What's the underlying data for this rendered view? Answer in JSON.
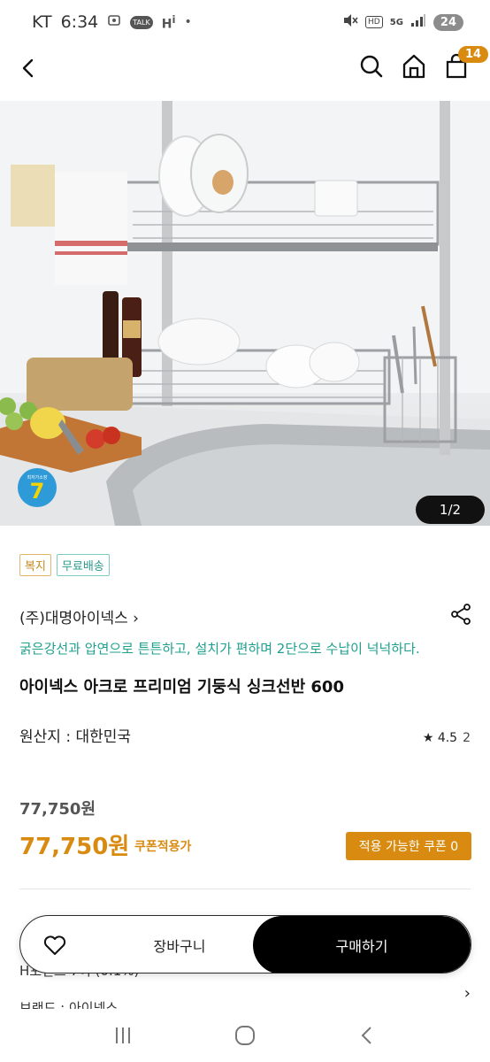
{
  "status_bar": {
    "carrier": "KT",
    "time": "6:34",
    "talk_badge": "TALK",
    "hd_badge": "HD",
    "network": "5G",
    "battery": "24"
  },
  "header": {
    "cart_count": "14",
    "icons": [
      "back-icon",
      "search-icon",
      "home-icon",
      "cart-icon"
    ]
  },
  "hero": {
    "page_indicator": "1/2",
    "sticker_label": "최저가소장",
    "sticker_number": "7"
  },
  "product": {
    "tags": [
      "복지",
      "무료배송"
    ],
    "brand": "(주)대명아이넥스 ›",
    "tagline": "굵은강선과 압연으로 튼튼하고, 설치가 편하며 2단으로 수납이 넉넉하다.",
    "title": "아이넥스 아크로 프리미엄 기둥식 싱크선반 600",
    "origin": "원산지 : 대한민국",
    "rating_star": "★ 4.5",
    "rating_count": "2",
    "original_price": "77,750원",
    "sale_price": "77,750원",
    "coupon_applied_label": "쿠폰적용가",
    "coupon_button": "적용 가능한 쿠폰 0"
  },
  "hidden_rows": {
    "row1_partial": "H포인트 7여 (0.1%)",
    "row2_partial": "브랜드 : 아이넥스"
  },
  "bottom_bar": {
    "cart_label": "장바구니",
    "buy_label": "구매하기"
  },
  "colors": {
    "accent": "#d88b10",
    "teal": "#1fa08e",
    "dark": "#000000"
  }
}
